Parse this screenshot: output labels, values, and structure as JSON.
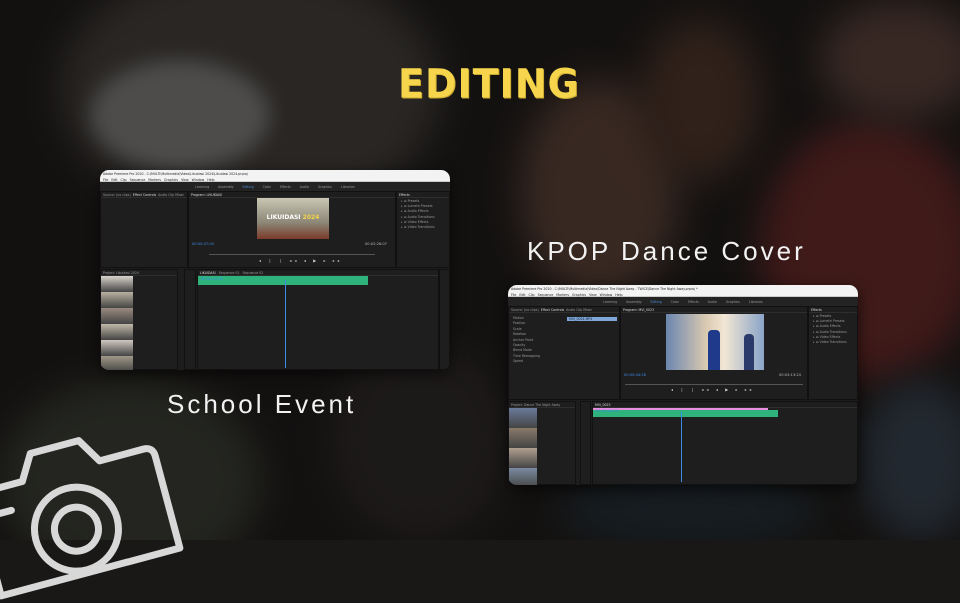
{
  "heading": "EDITING",
  "captions": {
    "school": "School Event",
    "kpop": "KPOP Dance Cover"
  },
  "colors": {
    "heading": "#f6d54c",
    "accent": "#3c8ae4",
    "clip_blue": "#7fa6d6",
    "clip_pink": "#e88ee0",
    "clip_green": "#4dbb72",
    "audio": "#2fb37c"
  },
  "app": {
    "menu": [
      "File",
      "Edit",
      "Clip",
      "Sequence",
      "Markers",
      "Graphics",
      "View",
      "Window",
      "Help"
    ],
    "workspaces": [
      "Learning",
      "Assembly",
      "Editing",
      "Color",
      "Effects",
      "Audio",
      "Graphics",
      "Libraries"
    ],
    "active_workspace": "Editing",
    "effects_items": [
      "Presets",
      "Lumetri Presets",
      "Audio Effects",
      "Audio Transitions",
      "Video Effects",
      "Video Transitions"
    ]
  },
  "school_window": {
    "title": "Adobe Premiere Pro 2020 - C:\\MULTI\\Multimedia\\Video\\Likuidasi 2024\\Likuidasi 2024.prproj",
    "source_tabs": [
      "Source: (no clips)",
      "Effect Controls",
      "Audio Clip Mixer"
    ],
    "program_tab": "Program: LIKUIDASI",
    "effects_tab": "Effects",
    "overlay_text": "LIKUIDASI",
    "overlay_year": "2024",
    "timecode": "00:00:47:04",
    "duration": "00:02:28:07",
    "fit": "Fit",
    "project_tab": "Project: Likuidasi 2024",
    "sequence_tabs": [
      "LIKUIDASI",
      "Sequence 01",
      "Sequence 02"
    ],
    "timeline_timecode": "00:00:47:04"
  },
  "kpop_window": {
    "title": "Adobe Premiere Pro 2020 - C:\\MULTI\\Multimedia\\Video\\Dance The Night Away - TWICE\\Dance The Night Away.prproj *",
    "source_tabs": [
      "Source: (no clips)",
      "Effect Controls",
      "Audio Clip Mixer"
    ],
    "program_tab": "Program: MVI_0023",
    "effects_tab": "Effects",
    "effect_props": [
      "Motion",
      "Position",
      "Scale",
      "Rotation",
      "Anchor Point",
      "Opacity",
      "Blend Mode",
      "Time Remapping",
      "Speed"
    ],
    "clip_label": "MVI_0024.MP4",
    "timecode": "00:00:44:28",
    "duration": "00:03:13:24",
    "fit": "Fit",
    "project_tab": "Project: Dance The Night Away",
    "sequence_tabs": [
      "MVI_0023"
    ],
    "timeline_timecode": "00:00:44:28"
  }
}
